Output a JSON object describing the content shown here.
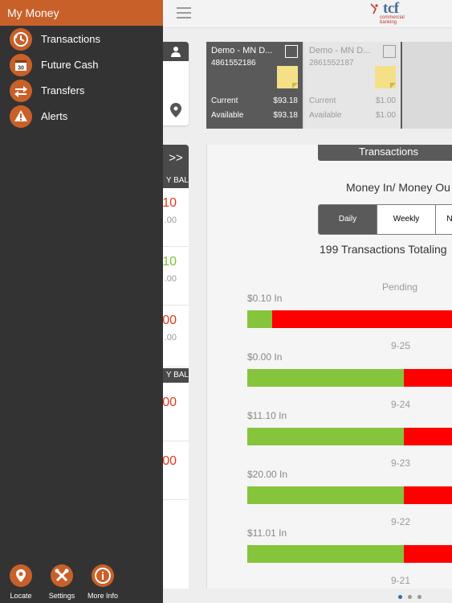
{
  "drawer": {
    "title": "My Money",
    "items": [
      {
        "label": "Transactions",
        "icon": "clock-history-icon"
      },
      {
        "label": "Future Cash",
        "icon": "calendar-icon"
      },
      {
        "label": "Transfers",
        "icon": "transfer-arrows-icon"
      },
      {
        "label": "Alerts",
        "icon": "alert-icon"
      }
    ],
    "bottom": [
      {
        "label": "Locate",
        "icon": "location-pin-icon"
      },
      {
        "label": "Settings",
        "icon": "tools-icon"
      },
      {
        "label": "More Info",
        "icon": "info-icon"
      }
    ]
  },
  "header": {
    "logo_text": "tcf",
    "logo_sub": "commercial banking"
  },
  "left_column": {
    "expand_label": ">>",
    "bal_heads": [
      "Y BAL",
      "Y BAL"
    ],
    "rows": [
      {
        "amount": "10",
        "sub": ".00",
        "color": "#e03a1e"
      },
      {
        "amount": "10",
        "sub": ".00",
        "color": "#7cc33a"
      },
      {
        "amount": "00",
        "sub": ".00",
        "color": "#e03a1e"
      },
      {
        "amount": "00",
        "sub": "",
        "color": "#e03a1e"
      },
      {
        "amount": "00",
        "sub": "",
        "color": "#e03a1e"
      }
    ]
  },
  "accounts": [
    {
      "name": "Demo - MN D...",
      "number": "4861552186",
      "current_label": "Current",
      "current": "$93.18",
      "available_label": "Available",
      "available": "$93.18",
      "selected": true
    },
    {
      "name": "Demo - MN D...",
      "number": "2861552187",
      "current_label": "Current",
      "current": "$1.00",
      "available_label": "Available",
      "available": "$1.00",
      "selected": false
    }
  ],
  "transactions": {
    "tab_label": "Transactions",
    "heading": "Money In/ Money Ou",
    "segments": [
      {
        "label": "Daily",
        "active": true
      },
      {
        "label": "Weekly",
        "active": false
      },
      {
        "label": "N",
        "active": false
      }
    ],
    "total_text": "199 Transactions Totaling",
    "periods": [
      {
        "label": "Pending",
        "in_label": "$0.10 In",
        "in_fraction": 0.12
      },
      {
        "label": "9-25",
        "in_label": "$0.00 In",
        "in_fraction": 0.75
      },
      {
        "label": "9-24",
        "in_label": "$11.10 In",
        "in_fraction": 0.75
      },
      {
        "label": "9-23",
        "in_label": "$20.00 In",
        "in_fraction": 0.75
      },
      {
        "label": "9-22",
        "in_label": "$11.01 In",
        "in_fraction": 0.75
      },
      {
        "label": "9-21",
        "in_label": "",
        "in_fraction": 0
      }
    ],
    "colors": {
      "in": "#86c43c",
      "out": "#ff0000"
    }
  },
  "pager": {
    "count": 3,
    "active": 0
  }
}
